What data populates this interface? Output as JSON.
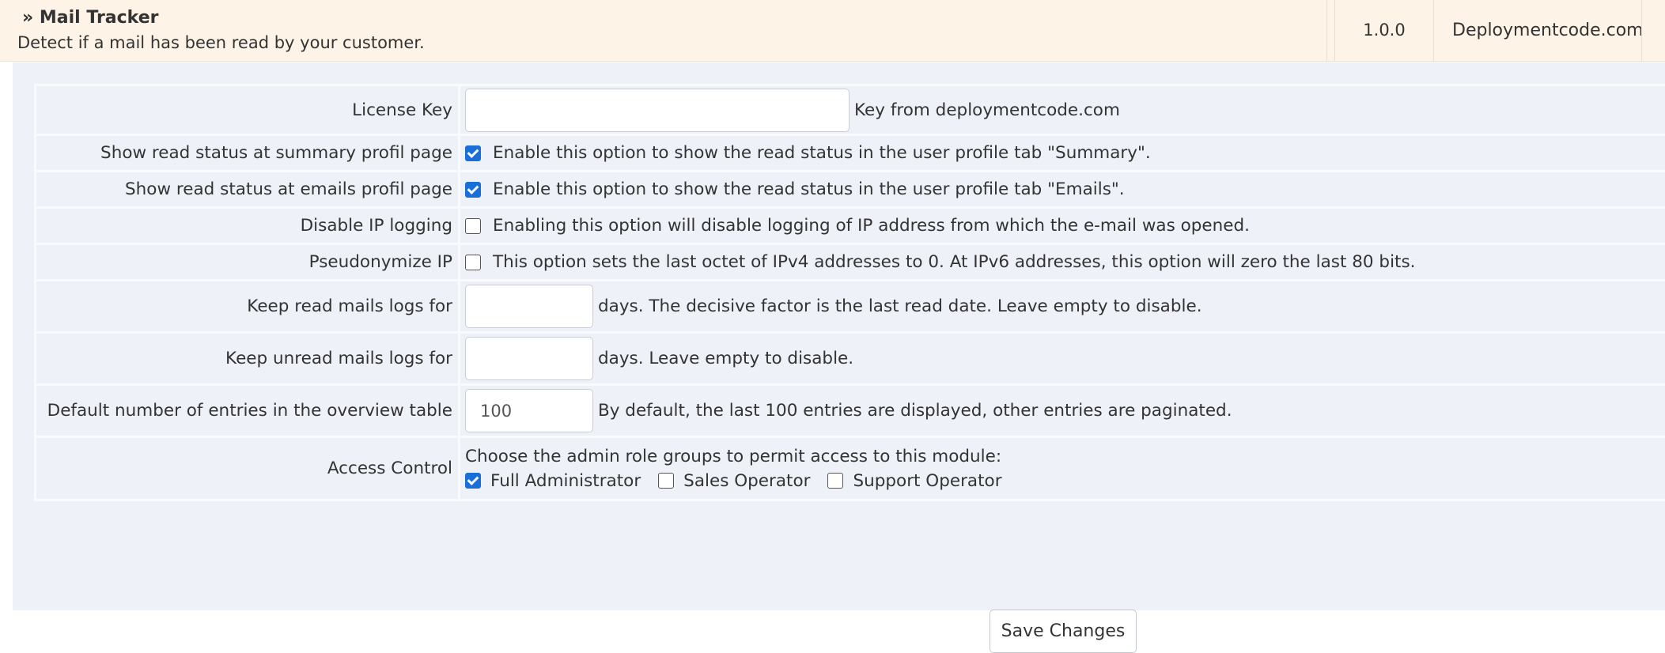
{
  "module": {
    "title": "» Mail Tracker",
    "description": "Detect if a mail has been read by your customer.",
    "version": "1.0.0",
    "vendor": "Deploymentcode.com"
  },
  "settings": {
    "license_key": {
      "label": "License Key",
      "value": "",
      "help": "Key from deploymentcode.com"
    },
    "summary_status": {
      "label": "Show read status at summary profil page",
      "checked": true,
      "help": "Enable this option to show the read status in the user profile tab \"Summary\"."
    },
    "emails_status": {
      "label": "Show read status at emails profil page",
      "checked": true,
      "help": "Enable this option to show the read status in the user profile tab \"Emails\"."
    },
    "disable_ip": {
      "label": "Disable IP logging",
      "checked": false,
      "help": "Enabling this option will disable logging of IP address from which the e-mail was opened."
    },
    "pseudonymize_ip": {
      "label": "Pseudonymize IP",
      "checked": false,
      "help": "This option sets the last octet of IPv4 addresses to 0. At IPv6 addresses, this option will zero the last 80 bits."
    },
    "keep_read": {
      "label": "Keep read mails logs for",
      "value": "",
      "help": "days. The decisive factor is the last read date. Leave empty to disable."
    },
    "keep_unread": {
      "label": "Keep unread mails logs for",
      "value": "",
      "help": "days. Leave empty to disable."
    },
    "default_entries": {
      "label": "Default number of entries in the overview table",
      "value": "100",
      "help": "By default, the last 100 entries are displayed, other entries are paginated."
    },
    "access_control": {
      "label": "Access Control",
      "intro": "Choose the admin role groups to permit access to this module:",
      "roles": [
        {
          "label": "Full Administrator",
          "checked": true
        },
        {
          "label": "Sales Operator",
          "checked": false
        },
        {
          "label": "Support Operator",
          "checked": false
        }
      ]
    }
  },
  "actions": {
    "save_label": "Save Changes"
  },
  "colors": {
    "header_bg": "#fdf3e6",
    "panel_bg": "#eef1f8",
    "checkbox_accent": "#1a6ed8"
  }
}
